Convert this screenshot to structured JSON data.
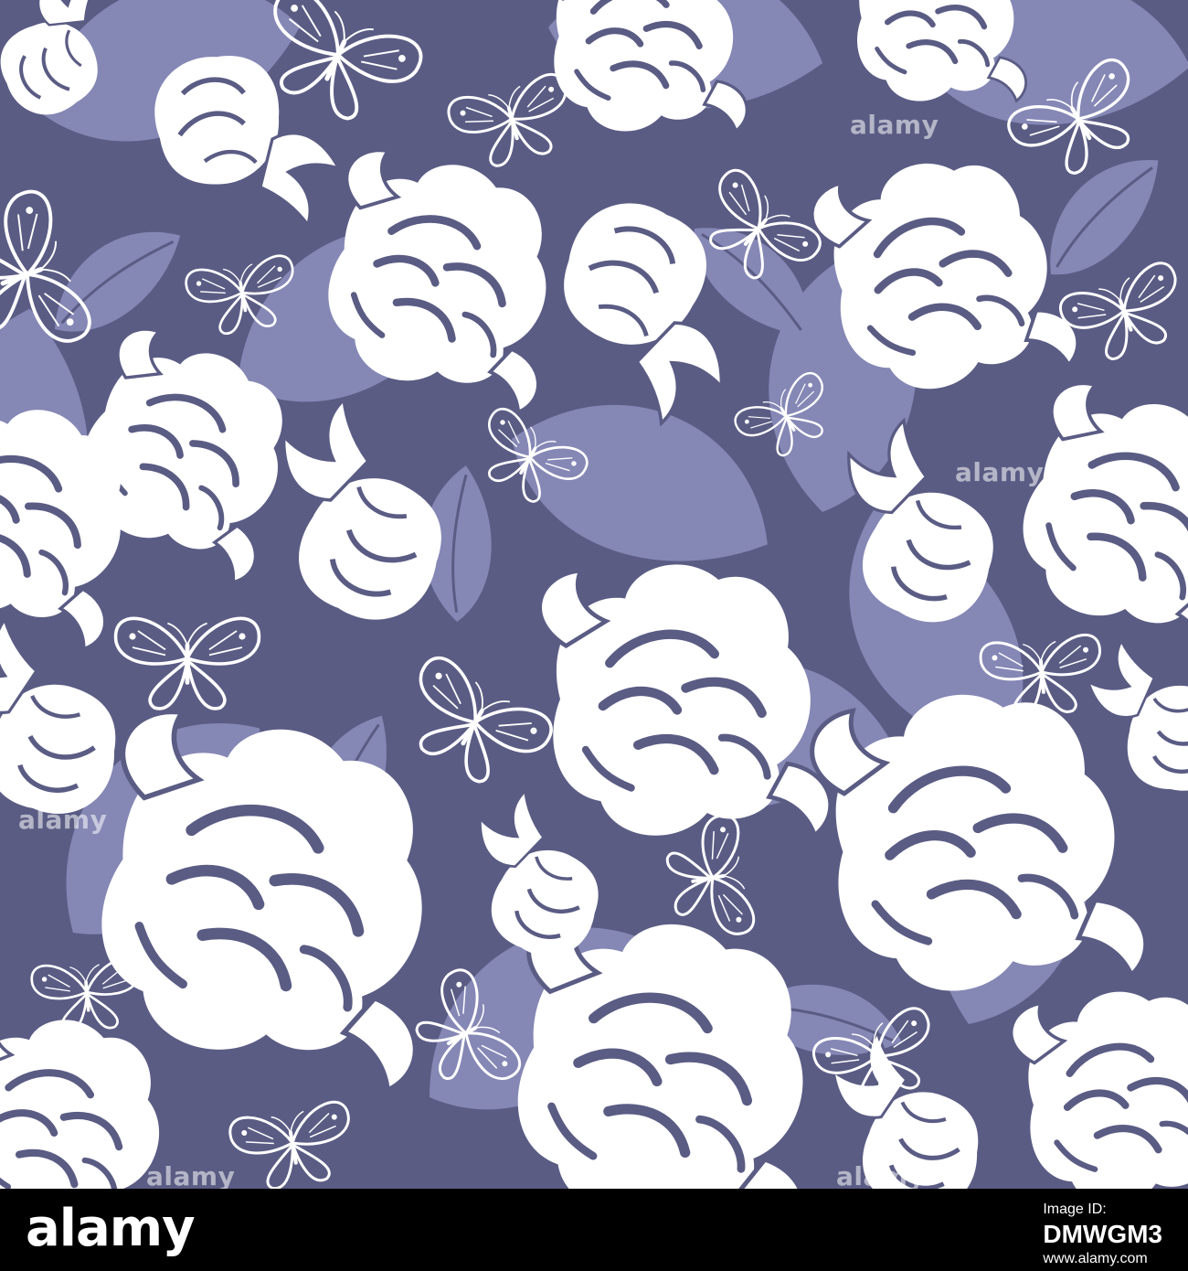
{
  "image": {
    "subject": "seamless floral pattern with roses, rosebuds and butterflies",
    "colors": {
      "background": "#5A5C84",
      "leaf": "#8587B5",
      "flower": "#FFFFFF",
      "footer": "#000000"
    }
  },
  "watermark": {
    "text": "alamy"
  },
  "footer": {
    "logo_text": "alamy",
    "label": "Image ID:",
    "image_id": "DMWGM3",
    "url": "www.alamy.com"
  }
}
